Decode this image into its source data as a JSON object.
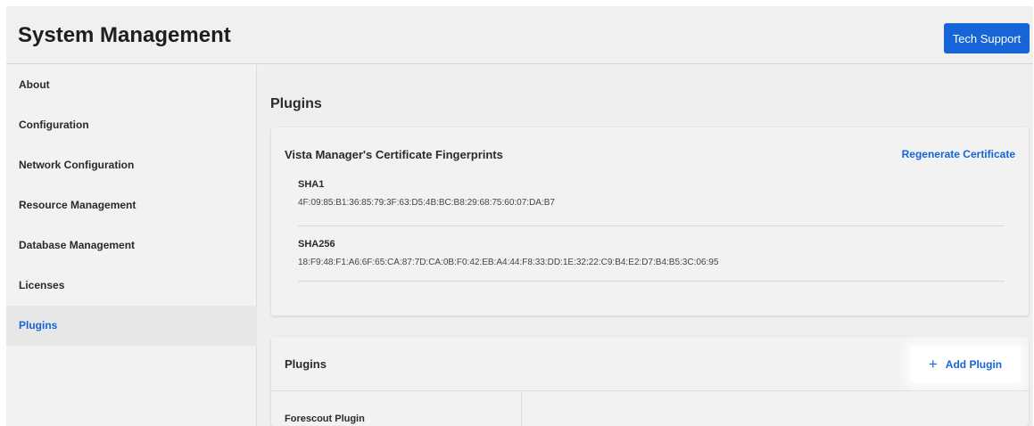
{
  "header": {
    "title": "System Management",
    "tech_support_label": "Tech Support"
  },
  "sidebar": {
    "items": [
      {
        "label": "About"
      },
      {
        "label": "Configuration"
      },
      {
        "label": "Network Configuration"
      },
      {
        "label": "Resource Management"
      },
      {
        "label": "Database Management"
      },
      {
        "label": "Licenses"
      },
      {
        "label": "Plugins",
        "active": true
      }
    ]
  },
  "main": {
    "title": "Plugins",
    "certificate_card": {
      "title": "Vista Manager's Certificate Fingerprints",
      "regenerate_label": "Regenerate Certificate",
      "fingerprints": [
        {
          "label": "SHA1",
          "value": "4F:09:85:B1:36:85:79:3F:63:D5:4B:BC:B8:29:68:75:60:07:DA:B7"
        },
        {
          "label": "SHA256",
          "value": "18:F9:48:F1:A6:6F:65:CA:87:7D:CA:0B:F0:42:EB:A4:44:F8:33:DD:1E:32:22:C9:B4:E2:D7:B4:B5:3C:06:95"
        }
      ]
    },
    "plugins_card": {
      "title": "Plugins",
      "add_plugin_label": "Add Plugin",
      "plugins": [
        {
          "name": "Forescout Plugin"
        }
      ]
    }
  },
  "colors": {
    "accent": "#1565d8",
    "background": "#f2f2f2"
  }
}
